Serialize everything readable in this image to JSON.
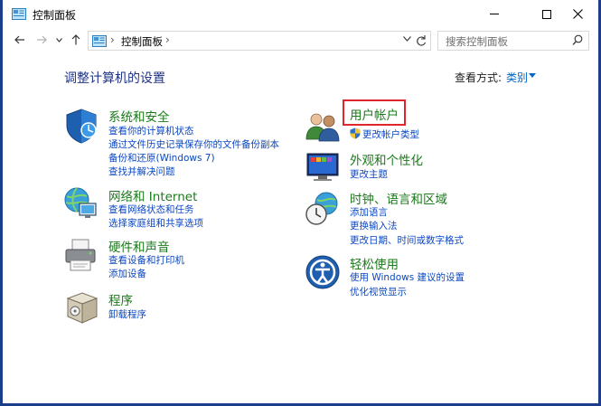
{
  "window": {
    "title": "控制面板"
  },
  "address": {
    "breadcrumb": "控制面板",
    "separator": "›",
    "search_placeholder": "搜索控制面板"
  },
  "content": {
    "heading": "调整计算机的设置",
    "view_by_label": "查看方式:",
    "view_by_value": "类别"
  },
  "categories_left": [
    {
      "title": "系统和安全",
      "icon": "shield-icon",
      "links": [
        "查看你的计算机状态",
        "通过文件历史记录保存你的文件备份副本",
        "备份和还原(Windows 7)",
        "查找并解决问题"
      ]
    },
    {
      "title": "网络和 Internet",
      "icon": "network-globe-icon",
      "links": [
        "查看网络状态和任务",
        "选择家庭组和共享选项"
      ]
    },
    {
      "title": "硬件和声音",
      "icon": "printer-icon",
      "links": [
        "查看设备和打印机",
        "添加设备"
      ]
    },
    {
      "title": "程序",
      "icon": "programs-box-icon",
      "links": [
        "卸载程序"
      ]
    }
  ],
  "categories_right": [
    {
      "title": "用户帐户",
      "icon": "users-icon",
      "links": [
        "更改帐户类型"
      ]
    },
    {
      "title": "外观和个性化",
      "icon": "monitor-palette-icon",
      "links": [
        "更改主题"
      ]
    },
    {
      "title": "时钟、语言和区域",
      "icon": "clock-globe-icon",
      "links": [
        "添加语言",
        "更换输入法",
        "更改日期、时间或数字格式"
      ]
    },
    {
      "title": "轻松使用",
      "icon": "accessibility-icon",
      "links": [
        "使用 Windows 建议的设置",
        "优化视觉显示"
      ]
    }
  ],
  "colors": {
    "heading": "#1e3287",
    "category_title": "#1b7a1b",
    "link": "#0a47c2",
    "highlight_box": "#e0262b",
    "frame": "#1c3d8a"
  }
}
